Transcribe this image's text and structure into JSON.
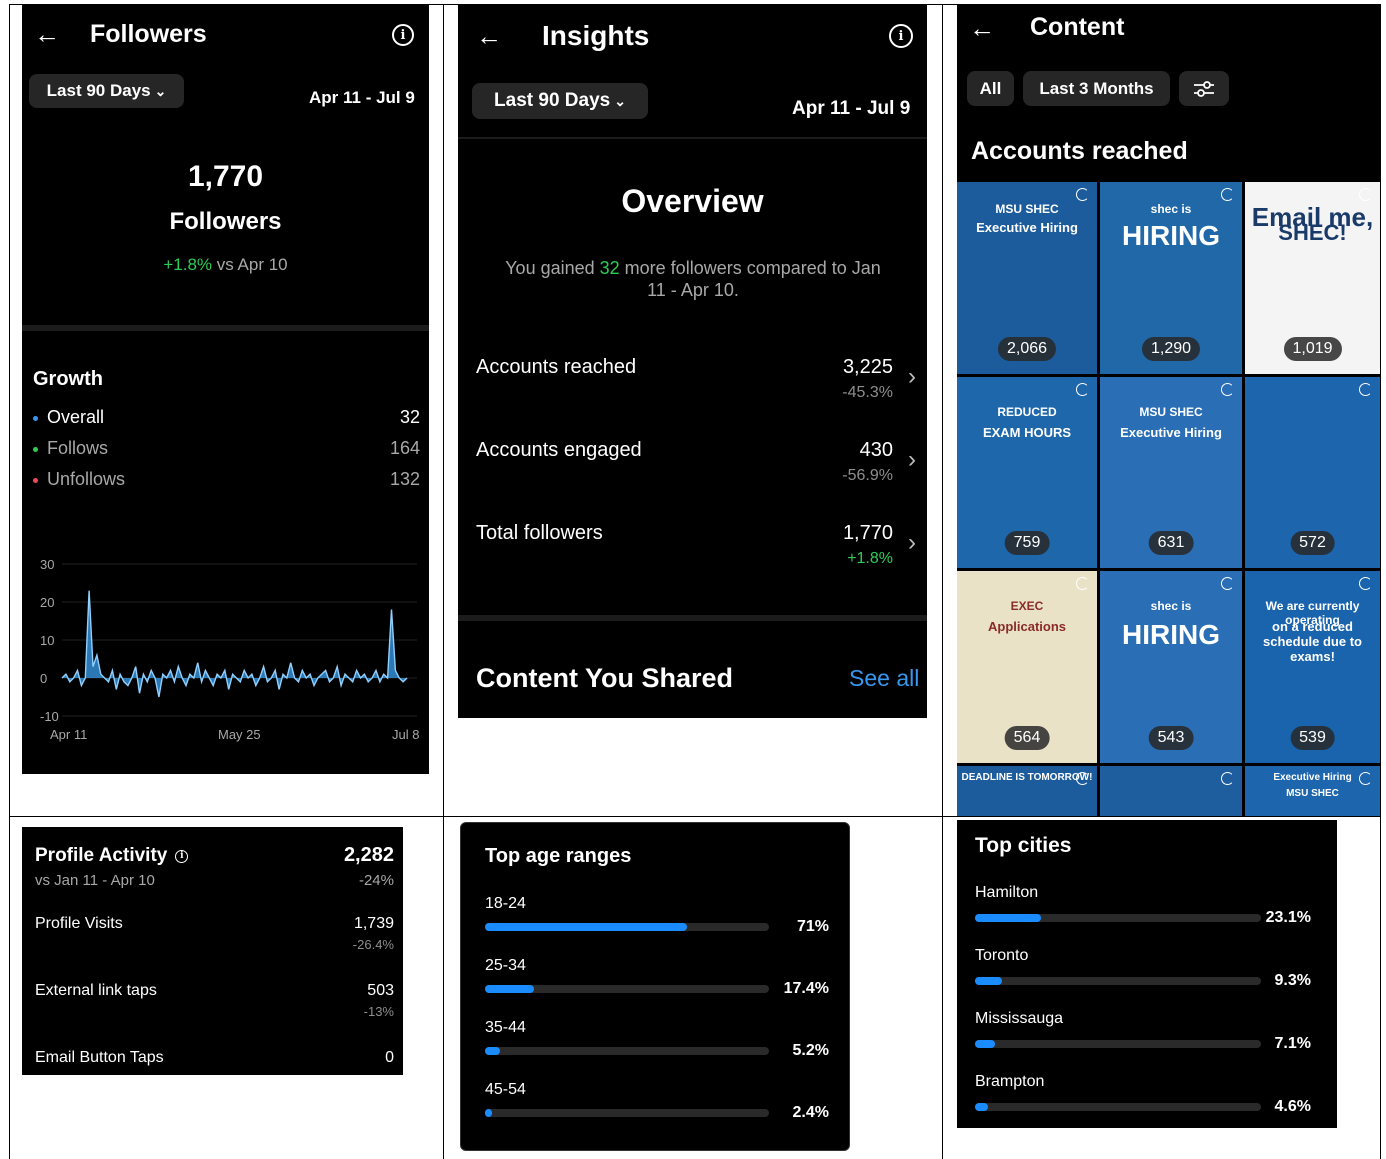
{
  "followers_panel": {
    "title": "Followers",
    "range_label": "Last 90 Days",
    "date_range": "Apr 11 - Jul 9",
    "count": "1,770",
    "count_label": "Followers",
    "change": "+1.8%",
    "change_suffix": "vs Apr 10",
    "growth": {
      "title": "Growth",
      "rows": [
        {
          "label": "Overall",
          "value": "32",
          "color": "#3897f0"
        },
        {
          "label": "Follows",
          "value": "164",
          "color": "#2ecc55"
        },
        {
          "label": "Unfollows",
          "value": "132",
          "color": "#ed4956"
        }
      ]
    }
  },
  "chart_data": {
    "type": "area",
    "yticks": [
      "30",
      "20",
      "10",
      "0",
      "-10"
    ],
    "ylim": [
      -10,
      30
    ],
    "xticks": [
      "Apr 11",
      "May 25",
      "Jul 8"
    ],
    "values": [
      0,
      1,
      -1,
      0,
      2,
      -2,
      0,
      23,
      3,
      6,
      1,
      0,
      -1,
      2,
      -3,
      1,
      -1,
      -2,
      0,
      3,
      -4,
      1,
      -1,
      2,
      0,
      -5,
      1,
      0,
      2,
      -1,
      3,
      0,
      -2,
      1,
      0,
      4,
      -1,
      2,
      0,
      -2,
      1,
      0,
      2,
      -3,
      1,
      0,
      -1,
      2,
      0,
      1,
      -2,
      0,
      3,
      -1,
      0,
      2,
      -3,
      1,
      0,
      4,
      0,
      -1,
      2,
      0,
      1,
      -2,
      0,
      1,
      2,
      -1,
      0,
      3,
      -2,
      1,
      0,
      -1,
      2,
      0,
      1,
      -1,
      0,
      2,
      -1,
      1,
      0,
      18,
      2,
      0,
      -1,
      0
    ],
    "color": "#3aa0f0"
  },
  "insights_panel": {
    "title": "Insights",
    "range_label": "Last 90 Days",
    "date_range": "Apr 11 - Jul 9",
    "overview_title": "Overview",
    "overview_pre": "You gained ",
    "overview_num": "32",
    "overview_post": " more followers compared to Jan 11 - Apr 10.",
    "rows": [
      {
        "label": "Accounts reached",
        "value": "3,225",
        "change": "-45.3%",
        "positive": false
      },
      {
        "label": "Accounts engaged",
        "value": "430",
        "change": "-56.9%",
        "positive": false
      },
      {
        "label": "Total followers",
        "value": "1,770",
        "change": "+1.8%",
        "positive": true
      }
    ],
    "shared_title": "Content You Shared",
    "see_all": "See all"
  },
  "content_panel": {
    "title": "Content",
    "filters": [
      "All",
      "Last 3 Months"
    ],
    "section_title": "Accounts reached",
    "tiles": [
      {
        "count": "2,066",
        "headline": "MSU SHEC",
        "sub": "Executive Hiring"
      },
      {
        "count": "1,290",
        "headline": "shec is",
        "sub": "HIRING"
      },
      {
        "count": "1,019",
        "headline": "Email me,",
        "sub": "SHEC!"
      },
      {
        "count": "759",
        "headline": "REDUCED",
        "sub": "EXAM HOURS"
      },
      {
        "count": "631",
        "headline": "MSU SHEC",
        "sub": "Executive Hiring"
      },
      {
        "count": "572",
        "headline": "",
        "sub": ""
      },
      {
        "count": "564",
        "headline": "EXEC",
        "sub": "Applications"
      },
      {
        "count": "543",
        "headline": "shec is",
        "sub": "HIRING"
      },
      {
        "count": "539",
        "headline": "We are currently operating",
        "sub": "on a reduced schedule due to exams!"
      },
      {
        "count": "",
        "headline": "",
        "sub": "DEADLINE IS TOMORROW!"
      },
      {
        "count": "",
        "headline": "",
        "sub": ""
      },
      {
        "count": "",
        "headline": "MSU SHEC",
        "sub": "Executive Hiring"
      }
    ]
  },
  "profile_activity": {
    "title": "Profile Activity",
    "total": "2,282",
    "subtitle": "vs Jan 11 - Apr 10",
    "total_change": "-24%",
    "rows": [
      {
        "label": "Profile Visits",
        "value": "1,739",
        "change": "-26.4%"
      },
      {
        "label": "External link taps",
        "value": "503",
        "change": "-13%"
      },
      {
        "label": "Email Button Taps",
        "value": "0",
        "change": ""
      }
    ]
  },
  "age_ranges": {
    "title": "Top age ranges",
    "rows": [
      {
        "label": "18-24",
        "pct": "71%",
        "fraction": 0.71
      },
      {
        "label": "25-34",
        "pct": "17.4%",
        "fraction": 0.174
      },
      {
        "label": "35-44",
        "pct": "5.2%",
        "fraction": 0.052
      },
      {
        "label": "45-54",
        "pct": "2.4%",
        "fraction": 0.024
      }
    ]
  },
  "top_cities": {
    "title": "Top cities",
    "rows": [
      {
        "label": "Hamilton",
        "pct": "23.1%",
        "fraction": 0.231
      },
      {
        "label": "Toronto",
        "pct": "9.3%",
        "fraction": 0.093
      },
      {
        "label": "Mississauga",
        "pct": "7.1%",
        "fraction": 0.071
      },
      {
        "label": "Brampton",
        "pct": "4.6%",
        "fraction": 0.046
      }
    ]
  }
}
